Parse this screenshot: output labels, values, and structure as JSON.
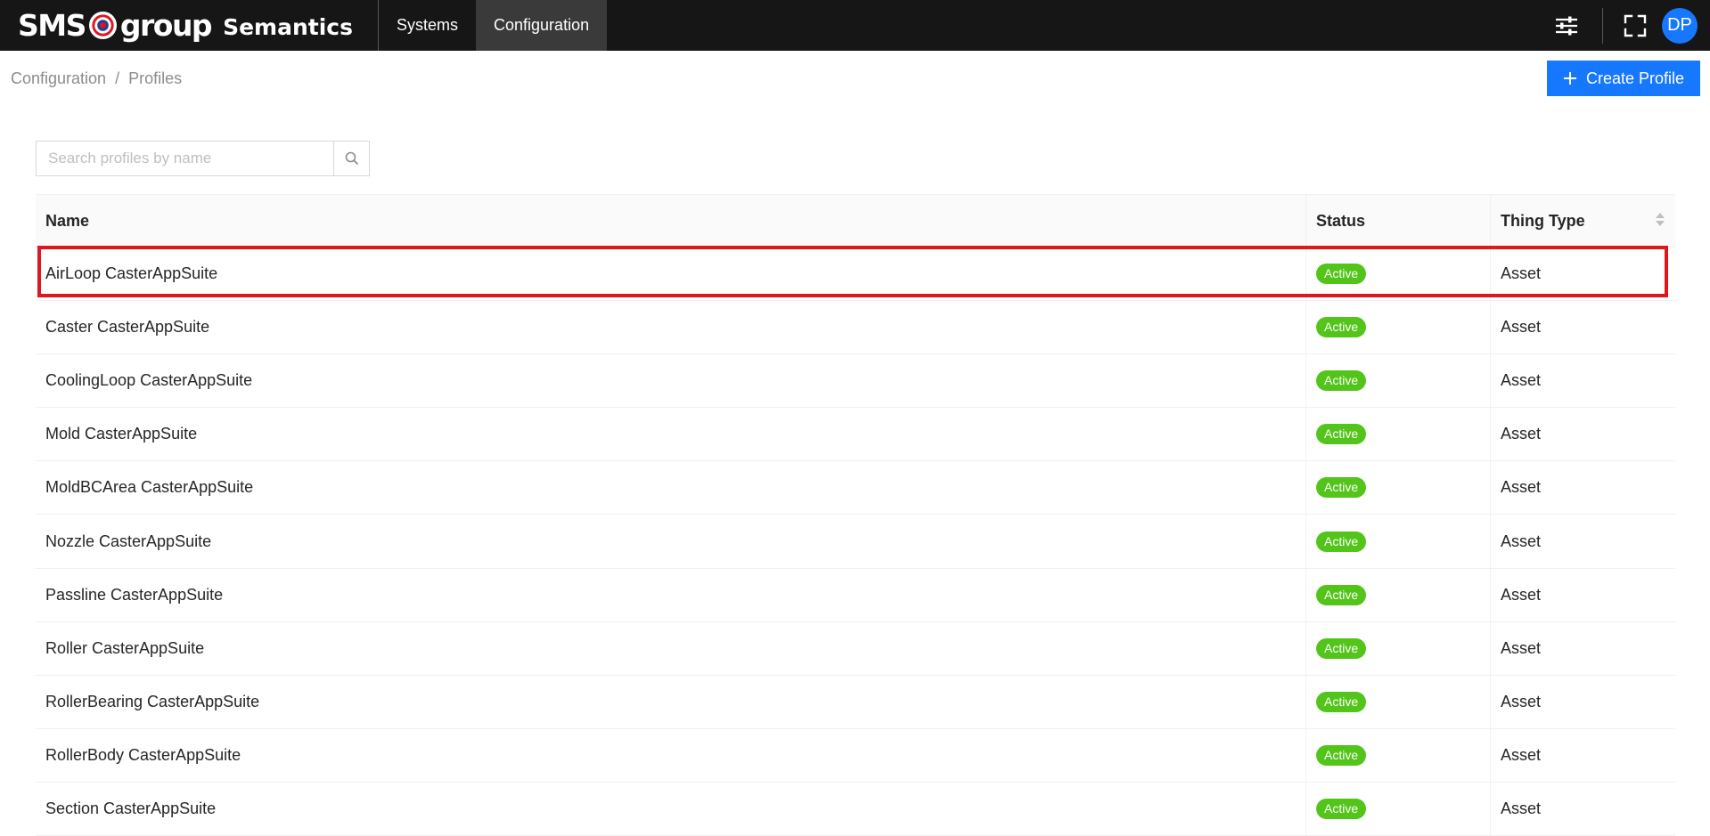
{
  "brand": {
    "sms": "SMS",
    "group": "group",
    "product": "Semantics",
    "logo_colors": [
      "#ffffff",
      "#e0161e",
      "#1f3f99"
    ]
  },
  "nav": {
    "items": [
      {
        "label": "Systems"
      },
      {
        "label": "Configuration"
      }
    ],
    "active": "Configuration"
  },
  "toolbar": {
    "settings_icon": "sliders-icon",
    "fullscreen_icon": "fullscreen-icon",
    "avatar_initials": "DP"
  },
  "breadcrumb": {
    "items": [
      {
        "label": "Configuration"
      },
      {
        "label": "Profiles"
      }
    ],
    "separator": "/"
  },
  "actions": {
    "create_label": "Create Profile",
    "create_icon": "plus-icon"
  },
  "search": {
    "placeholder": "Search profiles by name",
    "value": "",
    "icon": "search-icon"
  },
  "table": {
    "columns": [
      {
        "label": "Name"
      },
      {
        "label": "Status"
      },
      {
        "label": "Thing Type"
      }
    ],
    "rows": [
      {
        "name": "AirLoop CasterAppSuite",
        "status": "Active",
        "thing_type": "Asset"
      },
      {
        "name": "Caster CasterAppSuite",
        "status": "Active",
        "thing_type": "Asset"
      },
      {
        "name": "CoolingLoop CasterAppSuite",
        "status": "Active",
        "thing_type": "Asset"
      },
      {
        "name": "Mold CasterAppSuite",
        "status": "Active",
        "thing_type": "Asset"
      },
      {
        "name": "MoldBCArea CasterAppSuite",
        "status": "Active",
        "thing_type": "Asset"
      },
      {
        "name": "Nozzle CasterAppSuite",
        "status": "Active",
        "thing_type": "Asset"
      },
      {
        "name": "Passline CasterAppSuite",
        "status": "Active",
        "thing_type": "Asset"
      },
      {
        "name": "Roller CasterAppSuite",
        "status": "Active",
        "thing_type": "Asset"
      },
      {
        "name": "RollerBearing CasterAppSuite",
        "status": "Active",
        "thing_type": "Asset"
      },
      {
        "name": "RollerBody CasterAppSuite",
        "status": "Active",
        "thing_type": "Asset"
      },
      {
        "name": "Section CasterAppSuite",
        "status": "Active",
        "thing_type": "Asset"
      }
    ],
    "highlighted_row": "AirLoop CasterAppSuite"
  },
  "colors": {
    "topbar": "#161616",
    "accent": "#1677ff",
    "status_active": "#52c41a",
    "highlight": "#e0161e"
  }
}
